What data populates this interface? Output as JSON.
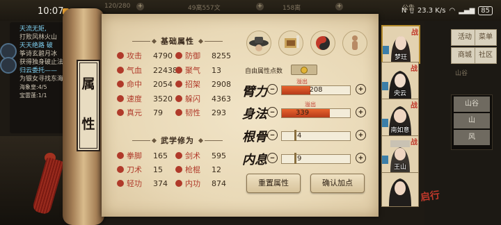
{
  "status": {
    "time": "10:07",
    "speed": "23.3 K/s",
    "battery": "85"
  },
  "top_resources": [
    "120/280",
    "49离557文",
    "158离"
  ],
  "top_right": "公告",
  "left_quests": [
    {
      "title": "天流无矩,",
      "desc": "打败风林火山"
    },
    {
      "title": "天天绝路 破",
      "desc": "筝诗玄碧月冰"
    },
    {
      "title": "",
      "desc": "获得独身破止法"
    },
    {
      "title": "归云委托——",
      "desc": "为银女寻找东海上宝材"
    },
    {
      "small": "海象皇:4/5"
    },
    {
      "small": "宝雷蓬:1/1"
    }
  ],
  "right_menu": [
    "活动",
    "菜单",
    "商城",
    "社区"
  ],
  "right_dim": "山谷",
  "location_list": [
    "山谷",
    "山",
    "风"
  ],
  "scroll_title": [
    "属",
    "性"
  ],
  "base_header": "基础属性",
  "base_attrs": [
    {
      "name": "攻击",
      "value": "4790"
    },
    {
      "name": "防御",
      "value": "8255"
    },
    {
      "name": "气血",
      "value": "22438"
    },
    {
      "name": "聚气",
      "value": "13"
    },
    {
      "name": "命中",
      "value": "2054"
    },
    {
      "name": "招架",
      "value": "2908"
    },
    {
      "name": "速度",
      "value": "3520"
    },
    {
      "name": "躲闪",
      "value": "4363"
    },
    {
      "name": "真元",
      "value": "79"
    },
    {
      "name": "韧性",
      "value": "293"
    }
  ],
  "martial_header": "武学修为",
  "martial_attrs": [
    {
      "name": "拳脚",
      "value": "165"
    },
    {
      "name": "剑术",
      "value": "595"
    },
    {
      "name": "刀术",
      "value": "15"
    },
    {
      "name": "枪棍",
      "value": "12"
    },
    {
      "name": "轻功",
      "value": "374"
    },
    {
      "name": "内功",
      "value": "874"
    }
  ],
  "free_points_label": "自由属性点数",
  "stat_bars": [
    {
      "label": "臂力",
      "value": "208",
      "fill": 0.42,
      "overflow": "溢出"
    },
    {
      "label": "身法",
      "value": "339",
      "fill": 0.7,
      "overflow": "溢出"
    },
    {
      "label": "根骨",
      "value": "4",
      "fill": 0.0,
      "overflow": ""
    },
    {
      "label": "内息",
      "value": "9",
      "fill": 0.0,
      "overflow": ""
    }
  ],
  "buttons": {
    "reset": "重置属性",
    "confirm": "确认加点"
  },
  "portraits": [
    {
      "name": "梦玨",
      "zhan": "战"
    },
    {
      "name": "央云",
      "zhan": "战"
    },
    {
      "name": "南如意",
      "zhan": "战"
    },
    {
      "name": "王山",
      "zhan": "战"
    },
    {
      "name": "",
      "zhan": "启行"
    }
  ],
  "colors": {
    "attr_red": "#b03a2a",
    "bar_fill": "#d9502a",
    "parchment": "#ecdcbc"
  }
}
